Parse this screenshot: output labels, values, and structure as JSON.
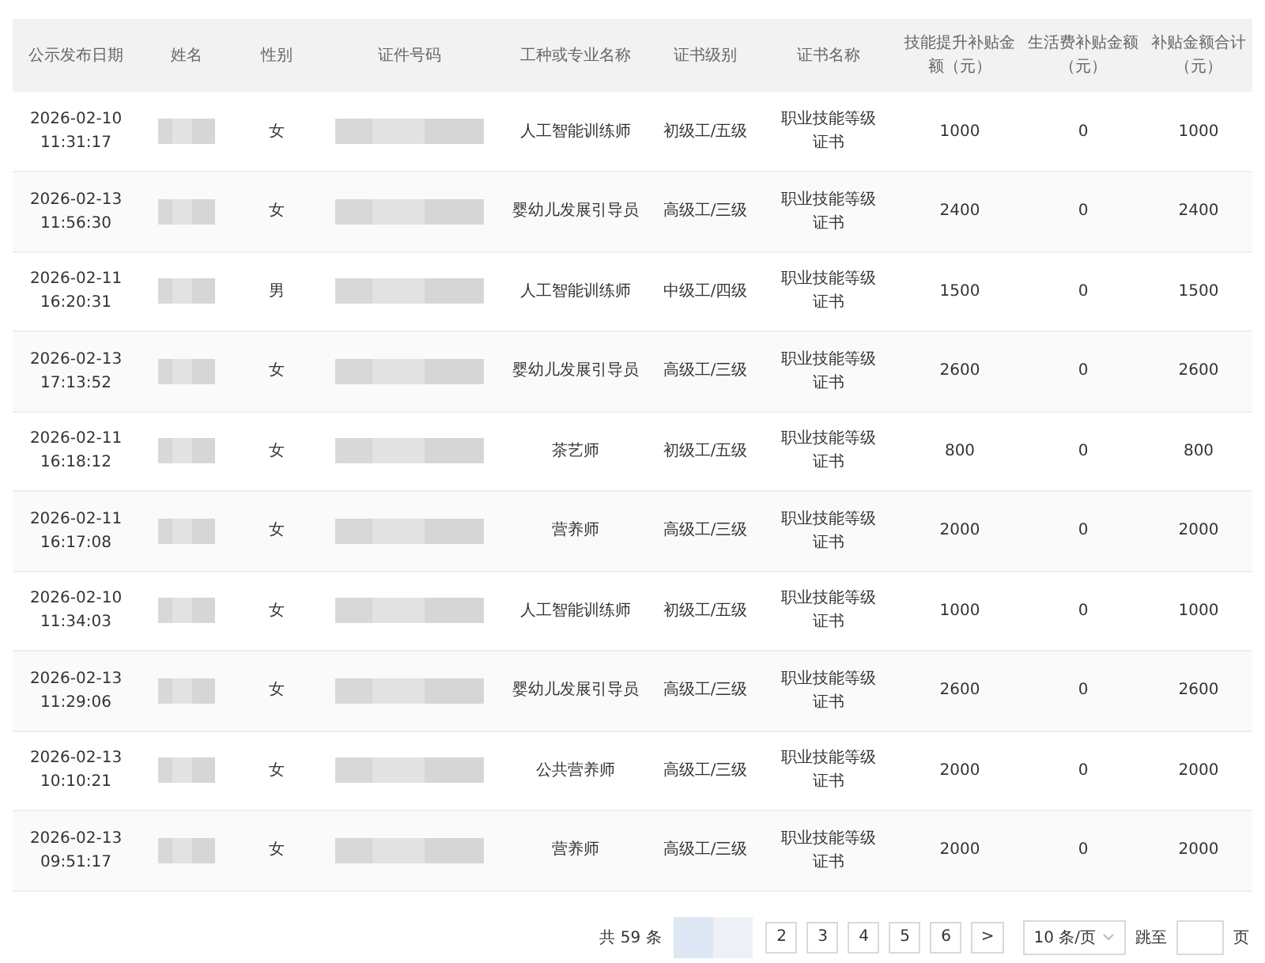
{
  "table": {
    "columns": [
      "公示发布日期",
      "姓名",
      "性别",
      "证件号码",
      "工种或专业名称",
      "证书级别",
      "证书名称",
      "技能提升补贴金额（元）",
      "生活费补贴金额（元）",
      "补贴金额合计（元）"
    ],
    "rows": [
      {
        "date": "2026-02-10",
        "time": "11:31:17",
        "gender": "女",
        "job": "人工智能训练师",
        "level": "初级工/五级",
        "cert": "职业技能等级证书",
        "skill": "1000",
        "living": "0",
        "total": "1000"
      },
      {
        "date": "2026-02-13",
        "time": "11:56:30",
        "gender": "女",
        "job": "婴幼儿发展引导员",
        "level": "高级工/三级",
        "cert": "职业技能等级证书",
        "skill": "2400",
        "living": "0",
        "total": "2400"
      },
      {
        "date": "2026-02-11",
        "time": "16:20:31",
        "gender": "男",
        "job": "人工智能训练师",
        "level": "中级工/四级",
        "cert": "职业技能等级证书",
        "skill": "1500",
        "living": "0",
        "total": "1500"
      },
      {
        "date": "2026-02-13",
        "time": "17:13:52",
        "gender": "女",
        "job": "婴幼儿发展引导员",
        "level": "高级工/三级",
        "cert": "职业技能等级证书",
        "skill": "2600",
        "living": "0",
        "total": "2600"
      },
      {
        "date": "2026-02-11",
        "time": "16:18:12",
        "gender": "女",
        "job": "茶艺师",
        "level": "初级工/五级",
        "cert": "职业技能等级证书",
        "skill": "800",
        "living": "0",
        "total": "800"
      },
      {
        "date": "2026-02-11",
        "time": "16:17:08",
        "gender": "女",
        "job": "营养师",
        "level": "高级工/三级",
        "cert": "职业技能等级证书",
        "skill": "2000",
        "living": "0",
        "total": "2000"
      },
      {
        "date": "2026-02-10",
        "time": "11:34:03",
        "gender": "女",
        "job": "人工智能训练师",
        "level": "初级工/五级",
        "cert": "职业技能等级证书",
        "skill": "1000",
        "living": "0",
        "total": "1000"
      },
      {
        "date": "2026-02-13",
        "time": "11:29:06",
        "gender": "女",
        "job": "婴幼儿发展引导员",
        "level": "高级工/三级",
        "cert": "职业技能等级证书",
        "skill": "2600",
        "living": "0",
        "total": "2600"
      },
      {
        "date": "2026-02-13",
        "time": "10:10:21",
        "gender": "女",
        "job": "公共营养师",
        "level": "高级工/三级",
        "cert": "职业技能等级证书",
        "skill": "2000",
        "living": "0",
        "total": "2000"
      },
      {
        "date": "2026-02-13",
        "time": "09:51:17",
        "gender": "女",
        "job": "营养师",
        "level": "高级工/三级",
        "cert": "职业技能等级证书",
        "skill": "2000",
        "living": "0",
        "total": "2000"
      }
    ]
  },
  "pagination": {
    "total": "共 59 条",
    "pages": [
      {
        "label": "2",
        "selected": false
      },
      {
        "label": "3",
        "selected": false
      },
      {
        "label": "4",
        "selected": false
      },
      {
        "label": "5",
        "selected": false
      },
      {
        "label": "6",
        "selected": false
      }
    ],
    "next": ">",
    "page_size": "10 条/页",
    "jump_label": "跳至",
    "page_suffix": "页"
  }
}
